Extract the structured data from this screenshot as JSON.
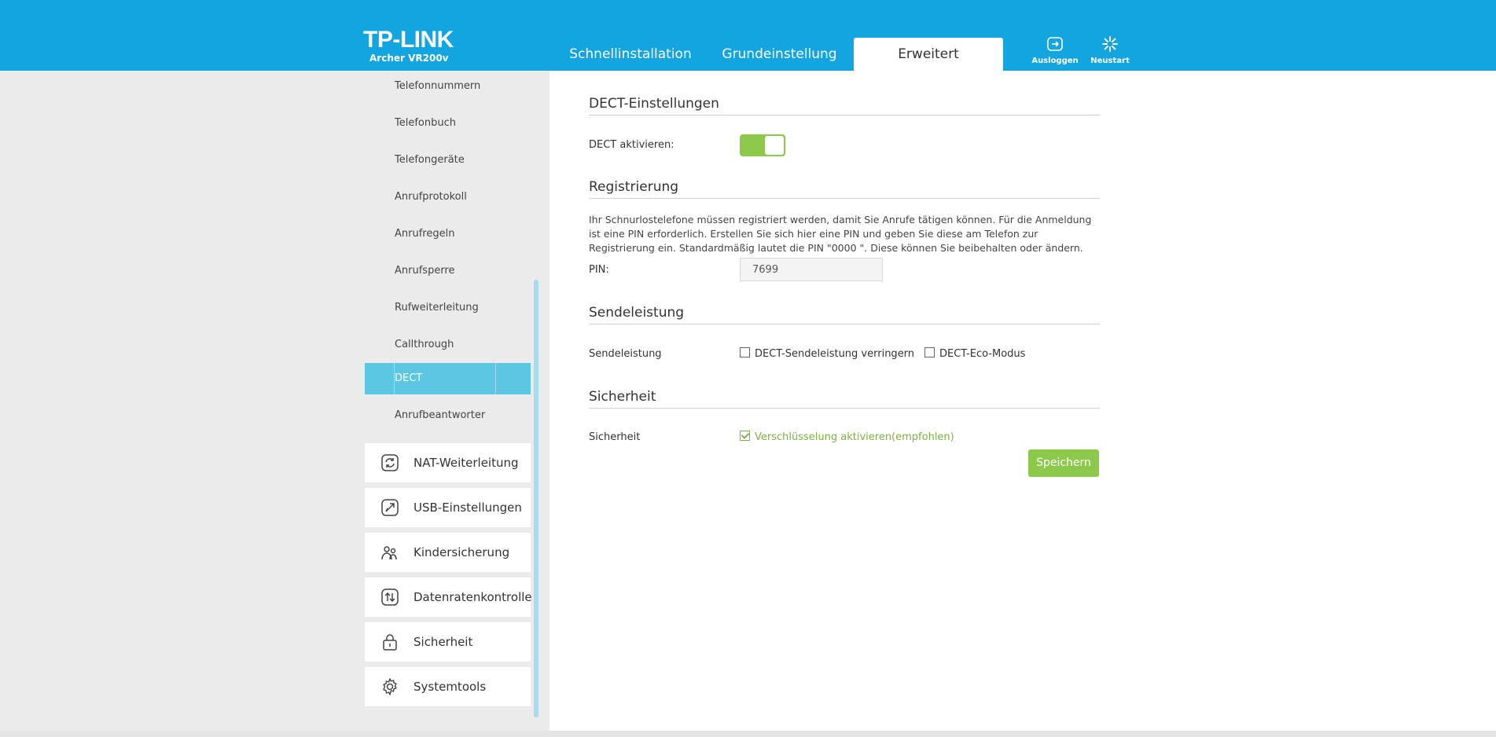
{
  "header": {
    "brand": "TP-LINK",
    "model": "Archer VR200v",
    "tabs": [
      "Schnellinstallation",
      "Grundeinstellung",
      "Erweitert"
    ],
    "active_tab": "Erweitert",
    "logout_label": "Ausloggen",
    "reboot_label": "Neustart"
  },
  "sidebar": {
    "subitems": [
      {
        "label": "Telefonnummern"
      },
      {
        "label": "Telefonbuch"
      },
      {
        "label": "Telefongeräte"
      },
      {
        "label": "Anrufprotokoll"
      },
      {
        "label": "Anrufregeln"
      },
      {
        "label": "Anrufsperre"
      },
      {
        "label": "Rufweiterleitung"
      },
      {
        "label": "Callthrough"
      },
      {
        "label": "DECT"
      },
      {
        "label": "Anrufbeantworter"
      }
    ],
    "active_subitem": "DECT",
    "menu": [
      {
        "label": "NAT-Weiterleitung",
        "icon": "nat-forwarding-icon"
      },
      {
        "label": "USB-Einstellungen",
        "icon": "usb-icon"
      },
      {
        "label": "Kindersicherung",
        "icon": "parental-control-icon"
      },
      {
        "label": "Datenratenkontrolle",
        "icon": "bandwidth-control-icon"
      },
      {
        "label": "Sicherheit",
        "icon": "lock-icon"
      },
      {
        "label": "Systemtools",
        "icon": "gear-icon"
      }
    ]
  },
  "main": {
    "dect_settings": {
      "title": "DECT-Einstellungen",
      "enable_label": "DECT aktivieren:",
      "enabled": true
    },
    "registration": {
      "title": "Registrierung",
      "description": "Ihr Schnurlostelefone müssen registriert werden, damit Sie Anrufe tätigen können. Für die Anmeldung ist eine PIN erforderlich. Erstellen Sie sich hier eine PIN und geben Sie diese am Telefon zur Registrierung ein. Standardmäßig lautet die PIN \"0000 \". Diese können Sie beibehalten oder ändern.",
      "pin_label": "PIN:",
      "pin_value": "7699"
    },
    "transmit_power": {
      "title": "Sendeleistung",
      "label": "Sendeleistung",
      "option1": "DECT-Sendeleistung verringern",
      "option1_checked": false,
      "option2": "DECT-Eco-Modus",
      "option2_checked": false
    },
    "security": {
      "title": "Sicherheit",
      "label": "Sicherheit",
      "option": "Verschlüsselung aktivieren(empfohlen)",
      "option_checked": true
    },
    "save_label": "Speichern"
  },
  "colors": {
    "header_blue": "#12a5e0",
    "active_item": "#5bc7e3",
    "accent_green": "#8cc94b"
  }
}
